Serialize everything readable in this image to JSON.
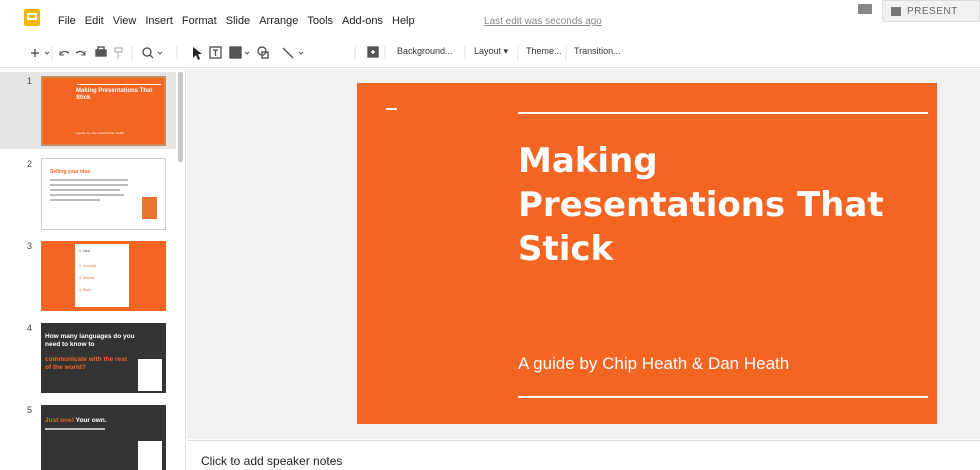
{
  "menubar": {
    "items": [
      "File",
      "Edit",
      "View",
      "Insert",
      "Format",
      "Slide",
      "Arrange",
      "Tools",
      "Add-ons",
      "Help"
    ],
    "last_edit": "Last edit was seconds ago",
    "present_label": "PRESENT"
  },
  "toolbar": {
    "background": "Background...",
    "layout": "Layout",
    "theme": "Theme...",
    "transition": "Transition..."
  },
  "filmstrip": {
    "slides": [
      {
        "num": "1",
        "title": "Making Presentations That Stick",
        "subtitle": "A guide by Chip Heath & Dan Heath"
      },
      {
        "num": "2",
        "title": "Selling your idea"
      },
      {
        "num": "3",
        "items": [
          "1. Idea",
          "2. Concept",
          "3. Source",
          "4. Story"
        ]
      },
      {
        "num": "4",
        "line1": "How many languages do you need to know to",
        "line2": "communicate with the rest of the world?"
      },
      {
        "num": "5",
        "line1": "Just one!",
        "line2": "Your own."
      }
    ]
  },
  "slide": {
    "title": "Making\nPresentations That\nStick",
    "subtitle": "A guide by Chip Heath & Dan Heath",
    "color": "#f26522"
  },
  "notes": {
    "placeholder": "Click to add speaker notes"
  }
}
